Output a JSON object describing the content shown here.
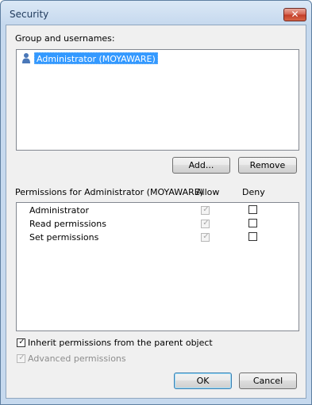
{
  "window": {
    "title": "Security"
  },
  "groups": {
    "label": "Group and usernames:",
    "items": [
      {
        "name": "Administrator (MOYAWARE)",
        "selected": true,
        "icon": "user-icon"
      }
    ]
  },
  "buttons": {
    "add": "Add...",
    "remove": "Remove",
    "ok": "OK",
    "cancel": "Cancel"
  },
  "permissions": {
    "label": "Permissions for Administrator (MOYAWARE)",
    "allow_header": "Allow",
    "deny_header": "Deny",
    "rows": [
      {
        "name": "Administrator",
        "allow": true,
        "deny": false
      },
      {
        "name": "Read permissions",
        "allow": true,
        "deny": false
      },
      {
        "name": "Set permissions",
        "allow": true,
        "deny": false
      }
    ]
  },
  "options": {
    "inherit": {
      "label": "Inherit permissions from the parent object",
      "checked": true
    },
    "advanced": {
      "label": "Advanced permissions",
      "checked": true,
      "disabled": true
    }
  }
}
